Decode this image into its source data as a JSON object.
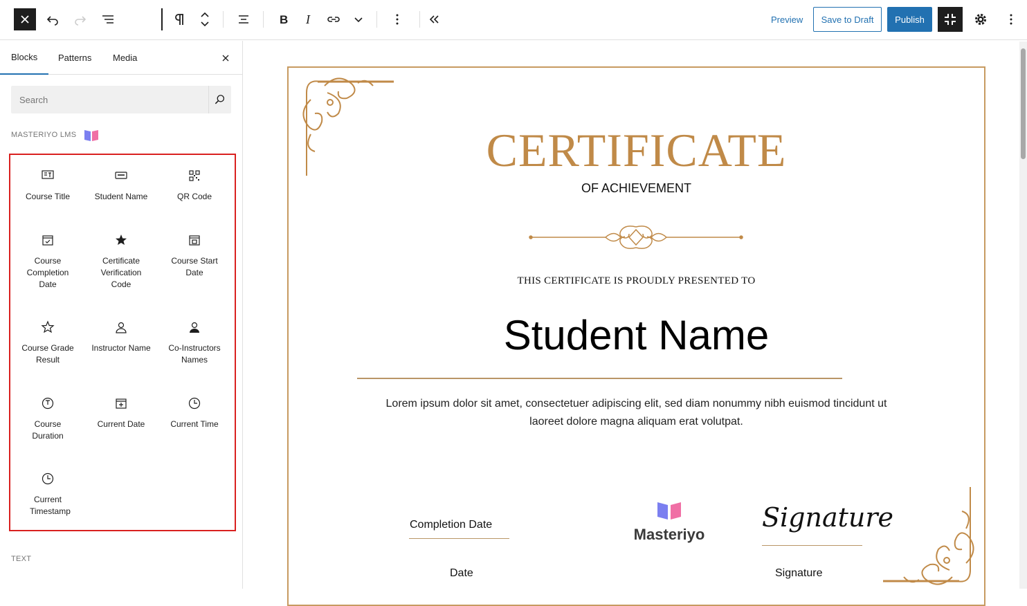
{
  "toolbar": {
    "preview_label": "Preview",
    "save_draft_label": "Save to Draft",
    "publish_label": "Publish"
  },
  "sidebar": {
    "tabs": [
      {
        "label": "Blocks"
      },
      {
        "label": "Patterns"
      },
      {
        "label": "Media"
      }
    ],
    "search_placeholder": "Search",
    "category_masteriyo": "MASTERIYO LMS",
    "category_text": "TEXT",
    "blocks": [
      {
        "label": "Course Title",
        "icon": "course-title-icon"
      },
      {
        "label": "Student Name",
        "icon": "student-name-icon"
      },
      {
        "label": "QR Code",
        "icon": "qr-code-icon"
      },
      {
        "label": "Course Completion Date",
        "icon": "calendar-check-icon"
      },
      {
        "label": "Certificate Verification Code",
        "icon": "star-badge-icon"
      },
      {
        "label": "Course Start Date",
        "icon": "calendar-icon"
      },
      {
        "label": "Course Grade Result",
        "icon": "star-icon"
      },
      {
        "label": "Instructor Name",
        "icon": "person-icon"
      },
      {
        "label": "Co-Instructors Names",
        "icon": "people-icon"
      },
      {
        "label": "Course Duration",
        "icon": "timer-icon"
      },
      {
        "label": "Current Date",
        "icon": "calendar-plus-icon"
      },
      {
        "label": "Current Time",
        "icon": "clock-icon"
      },
      {
        "label": "Current Timestamp",
        "icon": "clock-icon"
      }
    ]
  },
  "certificate": {
    "title": "CERTIFICATE",
    "subtitle": "OF ACHIEVEMENT",
    "presented": "THIS CERTIFICATE IS PROUDLY PRESENTED TO",
    "student_name": "Student Name",
    "body": "Lorem ipsum dolor sit amet, consectetuer adipiscing elit, sed diam nonummy nibh euismod tincidunt ut laoreet dolore magna aliquam erat volutpat.",
    "completion_label": "Completion Date",
    "date_label": "Date",
    "logo_text": "Masteriyo",
    "signature_script": "Signature",
    "signature_label": "Signature"
  },
  "colors": {
    "accent": "#2271b1",
    "gold": "#c08a48",
    "highlight_border": "#d9201f"
  }
}
